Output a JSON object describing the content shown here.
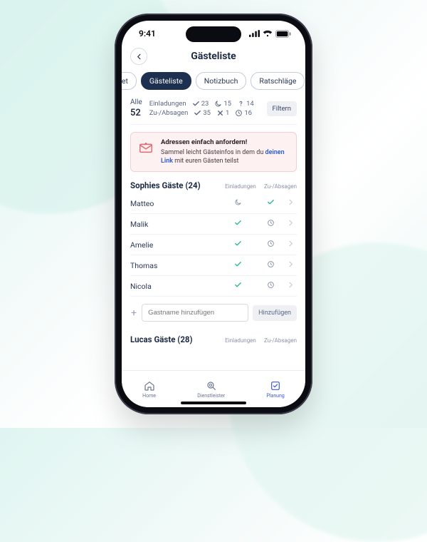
{
  "status": {
    "time": "9:41"
  },
  "header": {
    "title": "Gästeliste"
  },
  "tabs": [
    {
      "label": "get",
      "active": false
    },
    {
      "label": "Gästeliste",
      "active": true
    },
    {
      "label": "Notizbuch",
      "active": false
    },
    {
      "label": "Ratschläge",
      "active": false
    }
  ],
  "stats": {
    "all_label": "Alle",
    "all_count": "52",
    "lines": [
      {
        "label": "Einladungen",
        "a_icon": "check",
        "a": "23",
        "b_icon": "moon",
        "b": "15",
        "c_icon": "question",
        "c": "14"
      },
      {
        "label": "Zu-/Absagen",
        "a_icon": "check",
        "a": "35",
        "b_icon": "x",
        "b": "1",
        "c_icon": "clock",
        "c": "16"
      }
    ],
    "filter": "Filtern"
  },
  "banner": {
    "title": "Adressen einfach anfordern!",
    "text1": "Sammel leicht Gästeinfos in dem du ",
    "link": "deinen Link",
    "text2": " mit euren Gästen teilst"
  },
  "section1": {
    "title": "Sophies Gäste (24)",
    "col1": "Einladungen",
    "col2": "Zu-/Absagen",
    "guests": [
      {
        "name": "Matteo",
        "inv": "moon",
        "rsvp": "check"
      },
      {
        "name": "Malik",
        "inv": "check",
        "rsvp": "clock"
      },
      {
        "name": "Amelie",
        "inv": "check",
        "rsvp": "clock"
      },
      {
        "name": "Thomas",
        "inv": "check",
        "rsvp": "clock"
      },
      {
        "name": "Nicola",
        "inv": "check",
        "rsvp": "clock"
      }
    ]
  },
  "add": {
    "placeholder": "Gastname hinzufügen",
    "button": "Hinzufügen"
  },
  "section2": {
    "title": "Lucas Gäste (28)",
    "col1": "Einladungen",
    "col2": "Zu-/Absagen"
  },
  "tabbar": {
    "home": "Home",
    "vendors": "Dienstleister",
    "planning": "Planung"
  }
}
